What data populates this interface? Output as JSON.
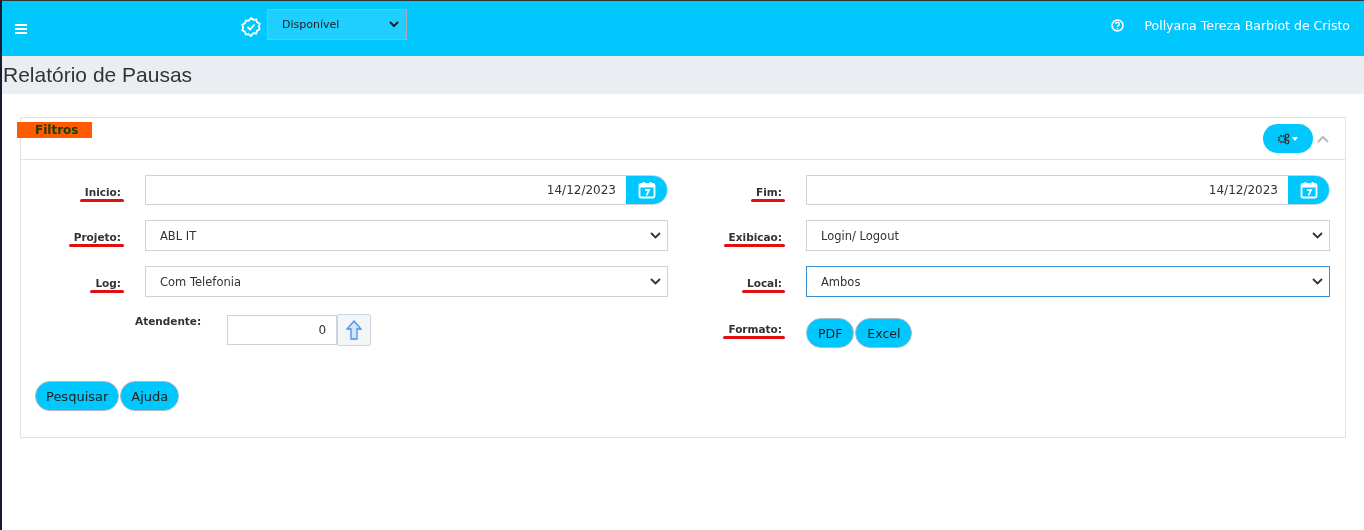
{
  "top_bar": {
    "status": {
      "value": "Disponível"
    },
    "user_name": "Pollyana Tereza Barbiot de Cristo"
  },
  "page_title": "Relatório de Pausas",
  "panel": {
    "title": "Filtros",
    "collapsed": false,
    "rows": [
      {
        "left": {
          "label": "Inicio:",
          "marked": true,
          "kind": "date",
          "value": "14/12/2023"
        },
        "right": {
          "label": "Fim:",
          "marked": true,
          "kind": "date",
          "value": "14/12/2023"
        }
      },
      {
        "left": {
          "label": "Projeto:",
          "marked": true,
          "kind": "select",
          "value": "ABL IT",
          "focused": false
        },
        "right": {
          "label": "Exibicao:",
          "marked": true,
          "kind": "select",
          "value": "Login/ Logout",
          "focused": false
        }
      },
      {
        "left": {
          "label": "Log:",
          "marked": true,
          "kind": "select",
          "value": "Com Telefonia",
          "focused": false
        },
        "right": {
          "label": "Local:",
          "marked": true,
          "kind": "select",
          "value": "Ambos",
          "focused": true
        }
      },
      {
        "left": {
          "label": "Atendente:",
          "marked": false,
          "kind": "number",
          "value": "0"
        },
        "right": {
          "label": "Formato:",
          "marked": true,
          "kind": "buttons",
          "buttons": [
            "PDF",
            "Excel"
          ]
        }
      }
    ],
    "actions": [
      "Pesquisar",
      "Ajuda"
    ]
  }
}
